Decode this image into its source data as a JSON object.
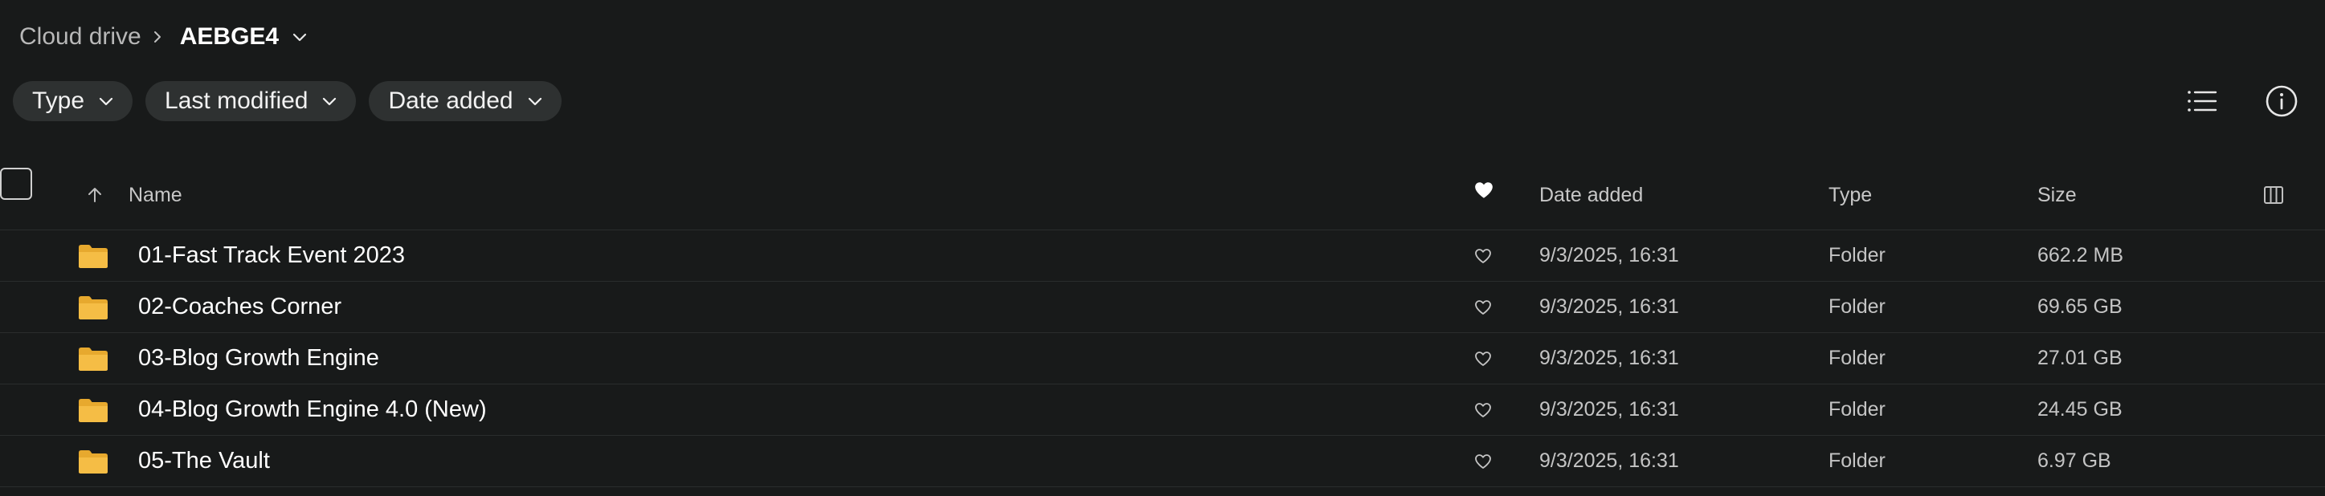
{
  "breadcrumb": {
    "root": "Cloud drive",
    "current": "AEBGE4"
  },
  "filters": [
    {
      "label": "Type"
    },
    {
      "label": "Last modified"
    },
    {
      "label": "Date added"
    }
  ],
  "table": {
    "columns": {
      "name": "Name",
      "date_added": "Date added",
      "type": "Type",
      "size": "Size"
    },
    "rows": [
      {
        "name": "01-Fast Track Event 2023",
        "date_added": "9/3/2025, 16:31",
        "type": "Folder",
        "size": "662.2 MB"
      },
      {
        "name": "02-Coaches Corner",
        "date_added": "9/3/2025, 16:31",
        "type": "Folder",
        "size": "69.65 GB"
      },
      {
        "name": "03-Blog Growth Engine",
        "date_added": "9/3/2025, 16:31",
        "type": "Folder",
        "size": "27.01 GB"
      },
      {
        "name": "04-Blog Growth Engine 4.0 (New)",
        "date_added": "9/3/2025, 16:31",
        "type": "Folder",
        "size": "24.45 GB"
      },
      {
        "name": "05-The Vault",
        "date_added": "9/3/2025, 16:31",
        "type": "Folder",
        "size": "6.97 GB"
      }
    ]
  },
  "colors": {
    "background": "#181a1a",
    "chip": "#2e3131",
    "folder": "#f0b93a",
    "divider": "#2a2d2d"
  },
  "icons": {
    "breadcrumb_separator": "chevron-right-icon",
    "breadcrumb_menu": "chevron-down-icon",
    "list_view": "list-view-icon",
    "info": "info-icon",
    "sort": "arrow-up-icon",
    "favorite_header": "heart-filled-icon",
    "favorite_row": "heart-outline-icon",
    "folder": "folder-icon",
    "columns": "columns-icon"
  }
}
